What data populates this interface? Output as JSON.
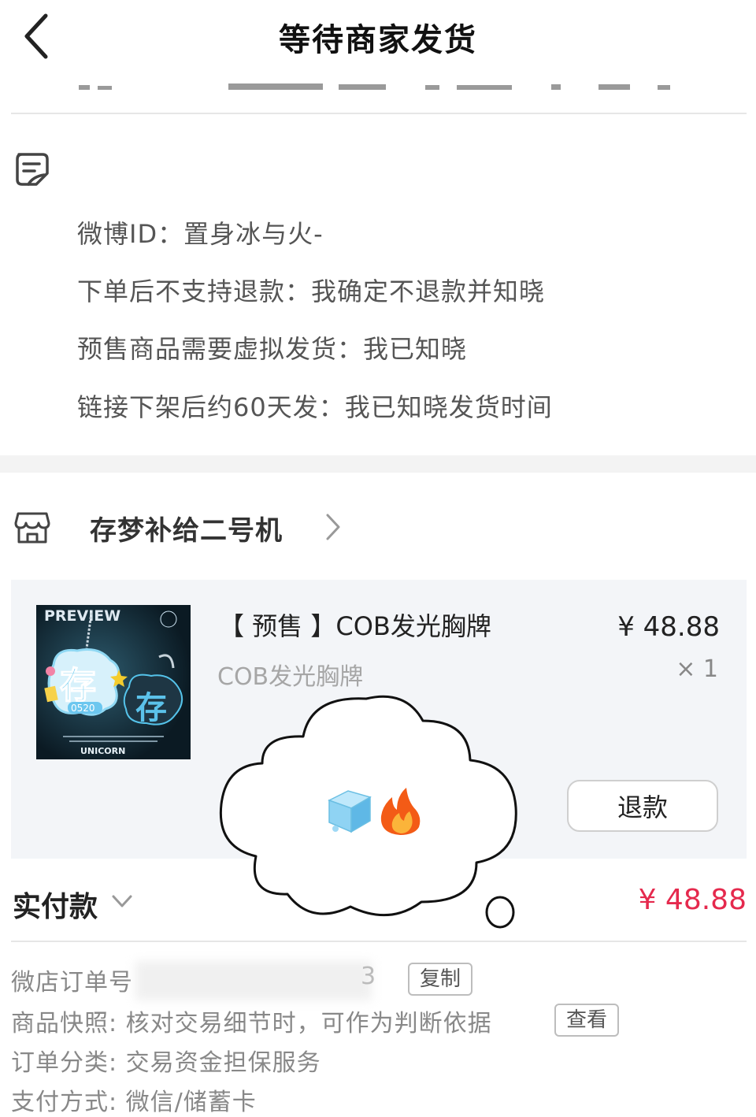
{
  "header": {
    "title": "等待商家发货"
  },
  "remark": {
    "lines": [
      "微博ID：置身冰与火-",
      "下单后不支持退款：我确定不退款并知晓",
      "预售商品需要虚拟发货：我已知晓",
      "链接下架后约60天发：我已知晓发货时间"
    ]
  },
  "shop": {
    "name": "存梦补给二号机"
  },
  "product": {
    "title": "【 预售 】COB发光胸牌",
    "spec": "COB发光胸牌",
    "price": "¥ 48.88",
    "quantity": "× 1",
    "refund_label": "退款",
    "thumbnail": {
      "preview_text": "PREVIEW",
      "main_char": "存",
      "second_char": "存",
      "number": "0520",
      "brand": "UNICORN"
    }
  },
  "payment": {
    "label": "实付款",
    "amount": "¥ 48.88"
  },
  "order_info": {
    "order_no_label": "微店订单号",
    "order_no_visible_tail": "3",
    "copy_label": "复制",
    "snapshot_text": "商品快照: 核对交易细节时，可作为判断依据",
    "view_label": "查看",
    "category_text": "订单分类:   交易资金担保服务",
    "payment_method_text": "支付方式:   微信/储蓄卡"
  },
  "overlay": {
    "emoji": "🧊🔥"
  },
  "colors": {
    "accent_red": "#e5294d",
    "card_bg": "#f3f5f8"
  },
  "icons": [
    "back-icon",
    "remark-icon",
    "shop-icon",
    "chevron-right-icon",
    "chevron-down-icon"
  ]
}
